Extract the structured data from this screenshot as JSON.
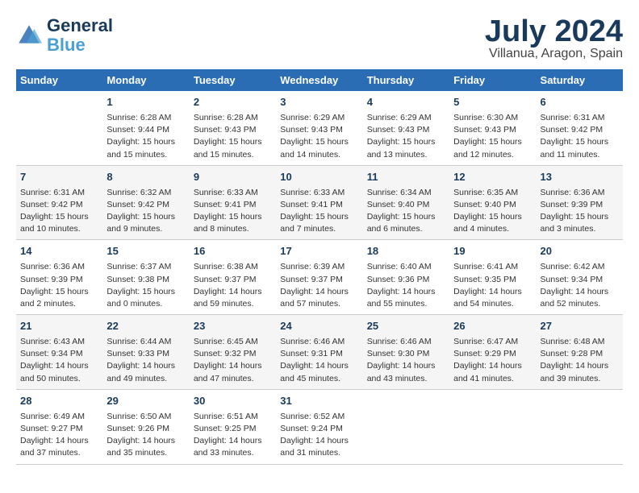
{
  "header": {
    "logo_line1": "General",
    "logo_line2": "Blue",
    "title": "July 2024",
    "subtitle": "Villanua, Aragon, Spain"
  },
  "calendar": {
    "days_of_week": [
      "Sunday",
      "Monday",
      "Tuesday",
      "Wednesday",
      "Thursday",
      "Friday",
      "Saturday"
    ],
    "weeks": [
      [
        {
          "num": "",
          "sunrise": "",
          "sunset": "",
          "daylight": ""
        },
        {
          "num": "1",
          "sunrise": "Sunrise: 6:28 AM",
          "sunset": "Sunset: 9:44 PM",
          "daylight": "Daylight: 15 hours and 15 minutes."
        },
        {
          "num": "2",
          "sunrise": "Sunrise: 6:28 AM",
          "sunset": "Sunset: 9:43 PM",
          "daylight": "Daylight: 15 hours and 15 minutes."
        },
        {
          "num": "3",
          "sunrise": "Sunrise: 6:29 AM",
          "sunset": "Sunset: 9:43 PM",
          "daylight": "Daylight: 15 hours and 14 minutes."
        },
        {
          "num": "4",
          "sunrise": "Sunrise: 6:29 AM",
          "sunset": "Sunset: 9:43 PM",
          "daylight": "Daylight: 15 hours and 13 minutes."
        },
        {
          "num": "5",
          "sunrise": "Sunrise: 6:30 AM",
          "sunset": "Sunset: 9:43 PM",
          "daylight": "Daylight: 15 hours and 12 minutes."
        },
        {
          "num": "6",
          "sunrise": "Sunrise: 6:31 AM",
          "sunset": "Sunset: 9:42 PM",
          "daylight": "Daylight: 15 hours and 11 minutes."
        }
      ],
      [
        {
          "num": "7",
          "sunrise": "Sunrise: 6:31 AM",
          "sunset": "Sunset: 9:42 PM",
          "daylight": "Daylight: 15 hours and 10 minutes."
        },
        {
          "num": "8",
          "sunrise": "Sunrise: 6:32 AM",
          "sunset": "Sunset: 9:42 PM",
          "daylight": "Daylight: 15 hours and 9 minutes."
        },
        {
          "num": "9",
          "sunrise": "Sunrise: 6:33 AM",
          "sunset": "Sunset: 9:41 PM",
          "daylight": "Daylight: 15 hours and 8 minutes."
        },
        {
          "num": "10",
          "sunrise": "Sunrise: 6:33 AM",
          "sunset": "Sunset: 9:41 PM",
          "daylight": "Daylight: 15 hours and 7 minutes."
        },
        {
          "num": "11",
          "sunrise": "Sunrise: 6:34 AM",
          "sunset": "Sunset: 9:40 PM",
          "daylight": "Daylight: 15 hours and 6 minutes."
        },
        {
          "num": "12",
          "sunrise": "Sunrise: 6:35 AM",
          "sunset": "Sunset: 9:40 PM",
          "daylight": "Daylight: 15 hours and 4 minutes."
        },
        {
          "num": "13",
          "sunrise": "Sunrise: 6:36 AM",
          "sunset": "Sunset: 9:39 PM",
          "daylight": "Daylight: 15 hours and 3 minutes."
        }
      ],
      [
        {
          "num": "14",
          "sunrise": "Sunrise: 6:36 AM",
          "sunset": "Sunset: 9:39 PM",
          "daylight": "Daylight: 15 hours and 2 minutes."
        },
        {
          "num": "15",
          "sunrise": "Sunrise: 6:37 AM",
          "sunset": "Sunset: 9:38 PM",
          "daylight": "Daylight: 15 hours and 0 minutes."
        },
        {
          "num": "16",
          "sunrise": "Sunrise: 6:38 AM",
          "sunset": "Sunset: 9:37 PM",
          "daylight": "Daylight: 14 hours and 59 minutes."
        },
        {
          "num": "17",
          "sunrise": "Sunrise: 6:39 AM",
          "sunset": "Sunset: 9:37 PM",
          "daylight": "Daylight: 14 hours and 57 minutes."
        },
        {
          "num": "18",
          "sunrise": "Sunrise: 6:40 AM",
          "sunset": "Sunset: 9:36 PM",
          "daylight": "Daylight: 14 hours and 55 minutes."
        },
        {
          "num": "19",
          "sunrise": "Sunrise: 6:41 AM",
          "sunset": "Sunset: 9:35 PM",
          "daylight": "Daylight: 14 hours and 54 minutes."
        },
        {
          "num": "20",
          "sunrise": "Sunrise: 6:42 AM",
          "sunset": "Sunset: 9:34 PM",
          "daylight": "Daylight: 14 hours and 52 minutes."
        }
      ],
      [
        {
          "num": "21",
          "sunrise": "Sunrise: 6:43 AM",
          "sunset": "Sunset: 9:34 PM",
          "daylight": "Daylight: 14 hours and 50 minutes."
        },
        {
          "num": "22",
          "sunrise": "Sunrise: 6:44 AM",
          "sunset": "Sunset: 9:33 PM",
          "daylight": "Daylight: 14 hours and 49 minutes."
        },
        {
          "num": "23",
          "sunrise": "Sunrise: 6:45 AM",
          "sunset": "Sunset: 9:32 PM",
          "daylight": "Daylight: 14 hours and 47 minutes."
        },
        {
          "num": "24",
          "sunrise": "Sunrise: 6:46 AM",
          "sunset": "Sunset: 9:31 PM",
          "daylight": "Daylight: 14 hours and 45 minutes."
        },
        {
          "num": "25",
          "sunrise": "Sunrise: 6:46 AM",
          "sunset": "Sunset: 9:30 PM",
          "daylight": "Daylight: 14 hours and 43 minutes."
        },
        {
          "num": "26",
          "sunrise": "Sunrise: 6:47 AM",
          "sunset": "Sunset: 9:29 PM",
          "daylight": "Daylight: 14 hours and 41 minutes."
        },
        {
          "num": "27",
          "sunrise": "Sunrise: 6:48 AM",
          "sunset": "Sunset: 9:28 PM",
          "daylight": "Daylight: 14 hours and 39 minutes."
        }
      ],
      [
        {
          "num": "28",
          "sunrise": "Sunrise: 6:49 AM",
          "sunset": "Sunset: 9:27 PM",
          "daylight": "Daylight: 14 hours and 37 minutes."
        },
        {
          "num": "29",
          "sunrise": "Sunrise: 6:50 AM",
          "sunset": "Sunset: 9:26 PM",
          "daylight": "Daylight: 14 hours and 35 minutes."
        },
        {
          "num": "30",
          "sunrise": "Sunrise: 6:51 AM",
          "sunset": "Sunset: 9:25 PM",
          "daylight": "Daylight: 14 hours and 33 minutes."
        },
        {
          "num": "31",
          "sunrise": "Sunrise: 6:52 AM",
          "sunset": "Sunset: 9:24 PM",
          "daylight": "Daylight: 14 hours and 31 minutes."
        },
        {
          "num": "",
          "sunrise": "",
          "sunset": "",
          "daylight": ""
        },
        {
          "num": "",
          "sunrise": "",
          "sunset": "",
          "daylight": ""
        },
        {
          "num": "",
          "sunrise": "",
          "sunset": "",
          "daylight": ""
        }
      ]
    ]
  }
}
